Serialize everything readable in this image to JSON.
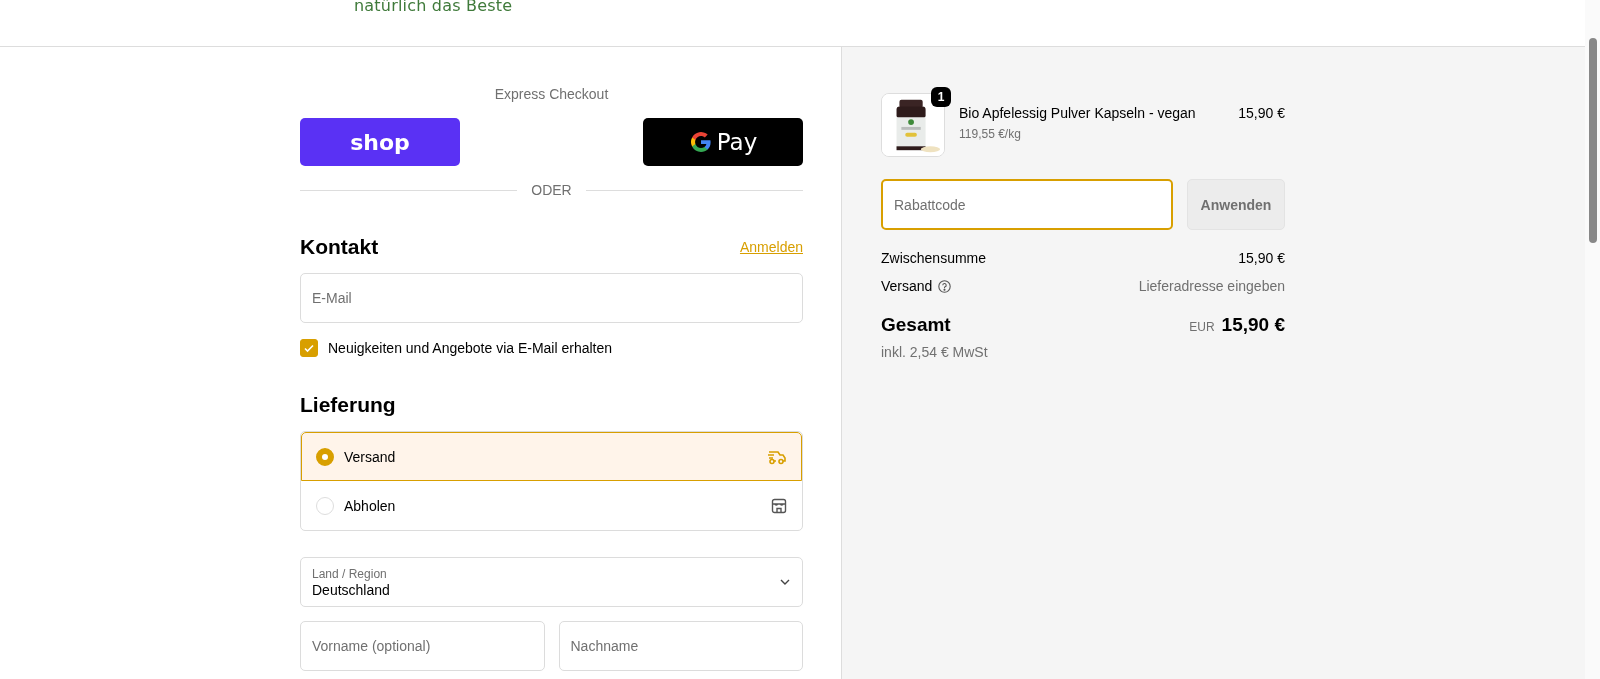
{
  "header": {
    "tagline": "natürlich das Beste"
  },
  "express_checkout": {
    "title": "Express Checkout",
    "buttons": [
      {
        "kind": "shop",
        "label": "shop"
      },
      {
        "kind": "gpay",
        "label": "Pay"
      }
    ],
    "divider": "ODER"
  },
  "contact": {
    "title": "Kontakt",
    "login_link": "Anmelden",
    "email": {
      "placeholder": "E-Mail"
    },
    "newsletter": {
      "label": "Neuigkeiten und Angebote via E-Mail erhalten",
      "checked": true
    }
  },
  "delivery": {
    "title": "Lieferung",
    "options": [
      {
        "label": "Versand",
        "kind": "ship",
        "selected": true
      },
      {
        "label": "Abholen",
        "kind": "pickup",
        "selected": false
      }
    ],
    "country": {
      "label": "Land / Region",
      "value": "Deutschland"
    },
    "first_name": {
      "placeholder": "Vorname (optional)"
    },
    "last_name": {
      "placeholder": "Nachname"
    }
  },
  "summary": {
    "items": [
      {
        "kind": "picture",
        "quantity": "1",
        "name": "Bio Apfelessig Pulver Kapseln - vegan",
        "unit_price": "119,55 €/kg",
        "price": "15,90 €"
      }
    ],
    "discount": {
      "placeholder": "Rabattcode",
      "button": "Anwenden"
    },
    "subtotal": {
      "label": "Zwischensumme",
      "value": "15,90 €"
    },
    "shipping": {
      "label": "Versand",
      "value": "Lieferadresse eingeben"
    },
    "total": {
      "label": "Gesamt",
      "currency": "EUR",
      "value": "15,90 €",
      "tax": "inkl. 2,54 € MwSt"
    }
  }
}
